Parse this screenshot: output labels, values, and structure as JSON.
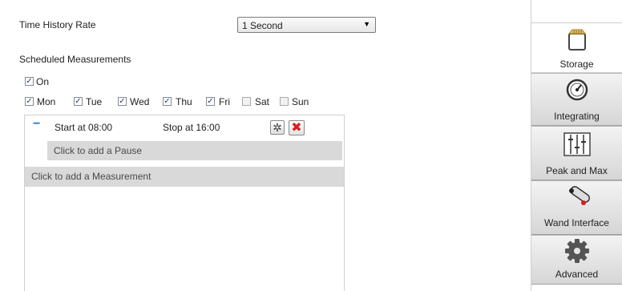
{
  "settings": {
    "time_history_label": "Time History Rate",
    "time_history_value": "1 Second",
    "scheduled_label": "Scheduled Measurements"
  },
  "schedule": {
    "on_label": "On",
    "on_checked": true,
    "days": [
      {
        "label": "Mon",
        "checked": true
      },
      {
        "label": "Tue",
        "checked": true
      },
      {
        "label": "Wed",
        "checked": true
      },
      {
        "label": "Thu",
        "checked": true
      },
      {
        "label": "Fri",
        "checked": true
      },
      {
        "label": "Sat",
        "checked": false
      },
      {
        "label": "Sun",
        "checked": false
      }
    ],
    "entry": {
      "start": "Start at 08:00",
      "stop": "Stop at 16:00",
      "add_pause": "Click to add a Pause"
    },
    "add_measurement": "Click to add a Measurement"
  },
  "sidebar": {
    "tabs": [
      {
        "label": "Storage",
        "icon": "sd-card-icon"
      },
      {
        "label": "Integrating",
        "icon": "gauge-icon"
      },
      {
        "label": "Peak and Max",
        "icon": "sliders-icon"
      },
      {
        "label": "Wand Interface",
        "icon": "wand-icon"
      },
      {
        "label": "Advanced",
        "icon": "gear-icon"
      }
    ]
  },
  "colors": {
    "accent_blue": "#1e6fd8",
    "delete_red": "#d81f1f",
    "row_gray": "#d9d9d9"
  }
}
